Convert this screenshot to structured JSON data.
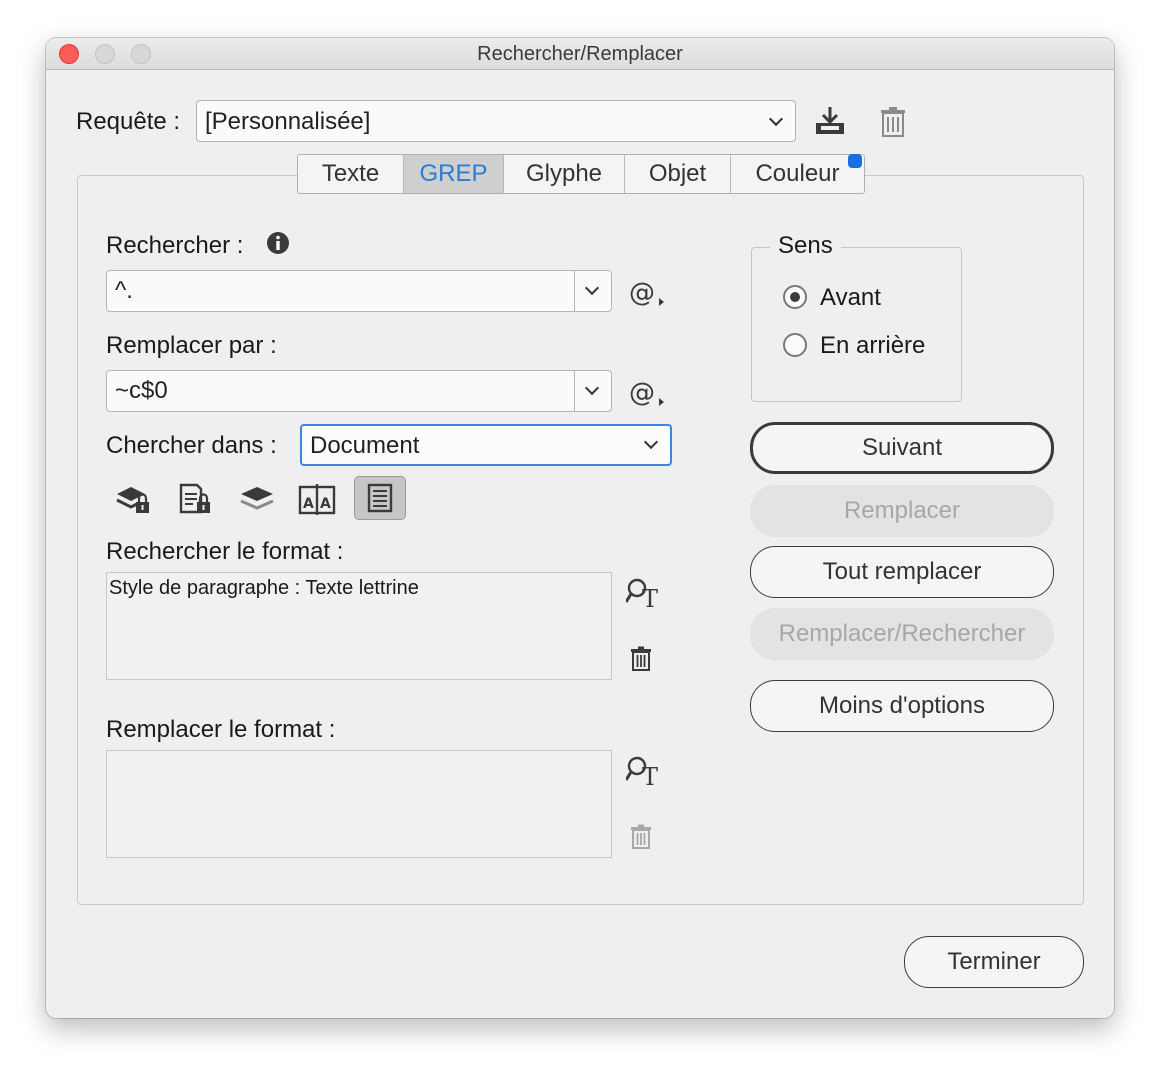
{
  "window": {
    "title": "Rechercher/Remplacer"
  },
  "query": {
    "label": "Requête :",
    "value": "[Personnalisée]",
    "save_icon": "save-query-icon",
    "delete_icon": "trash-icon"
  },
  "tabs": [
    {
      "label": "Texte",
      "active": false
    },
    {
      "label": "GREP",
      "active": true
    },
    {
      "label": "Glyphe",
      "active": false
    },
    {
      "label": "Objet",
      "active": false
    },
    {
      "label": "Couleur",
      "active": false
    }
  ],
  "search": {
    "label": "Rechercher :",
    "value": "^.",
    "info_icon": "info-icon",
    "special_icon": "at-special-characters-icon"
  },
  "replace": {
    "label": "Remplacer par :",
    "value": "~c$0",
    "special_icon": "at-special-characters-icon"
  },
  "scope": {
    "label": "Chercher dans :",
    "value": "Document"
  },
  "options_icons": [
    "include-locked-layers-icon",
    "include-locked-stories-icon",
    "include-hidden-layers-icon",
    "include-master-pages-icon",
    "include-footnotes-icon"
  ],
  "find_format": {
    "label": "Rechercher le format :",
    "value": "Style de paragraphe : Texte lettrine"
  },
  "change_format": {
    "label": "Remplacer le format :",
    "value": ""
  },
  "direction": {
    "label": "Sens",
    "options": [
      {
        "label": "Avant",
        "selected": true
      },
      {
        "label": "En arrière",
        "selected": false
      }
    ]
  },
  "buttons": {
    "next": "Suivant",
    "replace": "Remplacer",
    "replace_all": "Tout remplacer",
    "replace_find": "Remplacer/Rechercher",
    "fewer_options": "Moins d'options",
    "done": "Terminer"
  },
  "colors": {
    "accent": "#2a7ad9",
    "badge": "#1a6ee0",
    "close": "#fd5b55"
  }
}
